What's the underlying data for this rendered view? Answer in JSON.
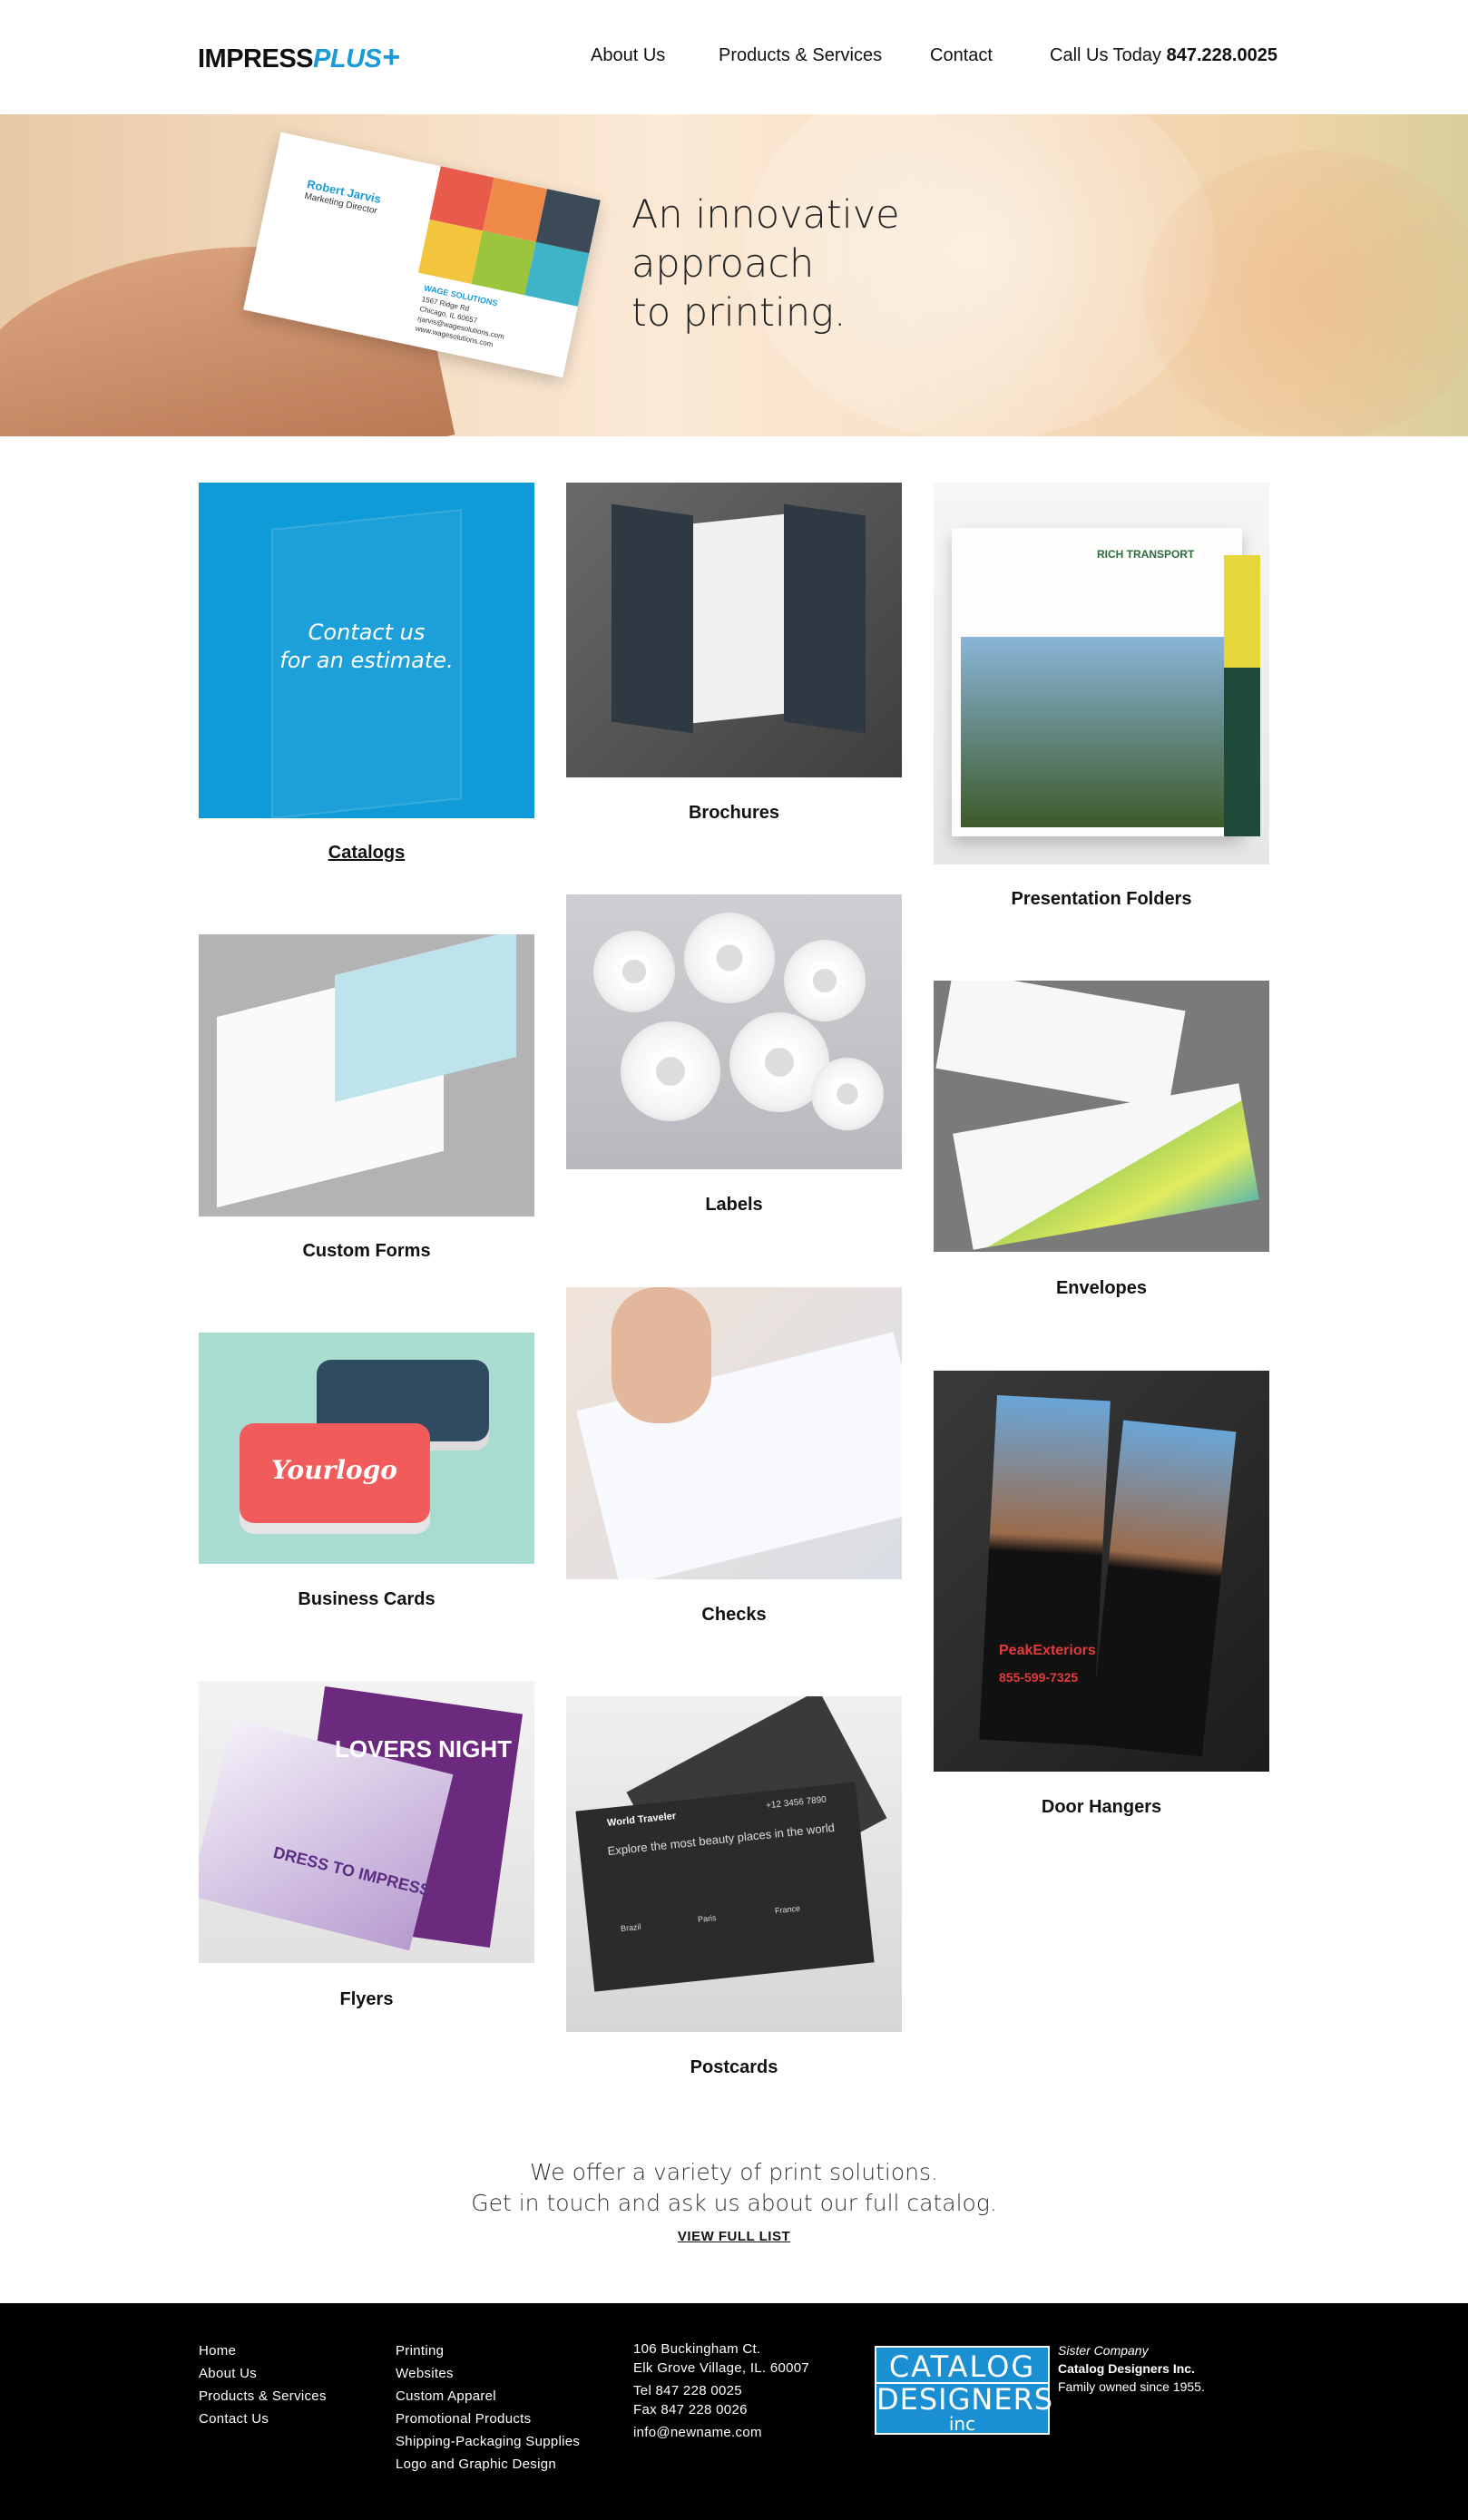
{
  "header": {
    "logo_main": "IMPRESS",
    "logo_plus": "PLUS",
    "logo_cross": "+",
    "nav": [
      "About Us",
      "Products & Services",
      "Contact"
    ],
    "call_label": "Call Us Today",
    "phone": "847.228.0025"
  },
  "hero": {
    "headline_lines": [
      "An innovative",
      "approach",
      "to printing."
    ],
    "card_name": "Robert Jarvis",
    "card_title": "Marketing Director",
    "card_company": "WAGE SOLUTIONS",
    "card_lines": [
      "1567 Ridge Rd",
      "Chicago, IL 60657",
      "rjarvis@wagesolutions.com",
      "www.wagesolutions.com"
    ]
  },
  "catalog_tile": {
    "cta_lines": [
      "Contact us",
      "for an estimate."
    ]
  },
  "products": [
    "Catalogs",
    "Brochures",
    "Presentation Folders",
    "Custom Forms",
    "Labels",
    "Envelopes",
    "Business Cards",
    "Checks",
    "Door Hangers",
    "Flyers",
    "Postcards"
  ],
  "image_text": {
    "folder_company": "RICH TRANSPORT",
    "bizcard_logo": "Yourlogo",
    "hanger_brand": "PeakExteriors",
    "hanger_phone": "855-599-7325",
    "flyer_title": "LOVERS NIGHT",
    "flyer_sub": "DRESS TO IMPRESS",
    "postcard_brand": "World Traveler",
    "postcard_text": "Explore the most beauty places in the world",
    "postcard_places": [
      "Brazil",
      "Paris",
      "France"
    ],
    "postcard_phone": "+12 3456 7890"
  },
  "offer": {
    "lines": [
      "We offer a variety of print solutions.",
      "Get in touch and ask us about our full catalog."
    ],
    "link": "VIEW FULL LIST"
  },
  "footer": {
    "nav": [
      "Home",
      "About Us",
      "Products & Services",
      "Contact Us"
    ],
    "services": [
      "Printing",
      "Websites",
      "Custom Apparel",
      "Promotional Products",
      "Shipping-Packaging Supplies",
      "Logo and Graphic Design"
    ],
    "address": [
      "106 Buckingham Ct.",
      "Elk Grove Village, IL. 60007"
    ],
    "contact": [
      "Tel 847 228 0025",
      "Fax 847 228 0026",
      "info@newname.com"
    ],
    "sister_logo": [
      "CATALOG",
      "DESIGNERS",
      "inc"
    ],
    "sister_label": "Sister Company",
    "sister_name": "Catalog Designers Inc.",
    "sister_note": "Family owned since 1955."
  },
  "colors": {
    "accent": "#1a9ad6",
    "catalog_tile": "#0f9bd7",
    "footer_bg": "#000000"
  },
  "icons": {
    "logo_cross": "plus-icon"
  }
}
